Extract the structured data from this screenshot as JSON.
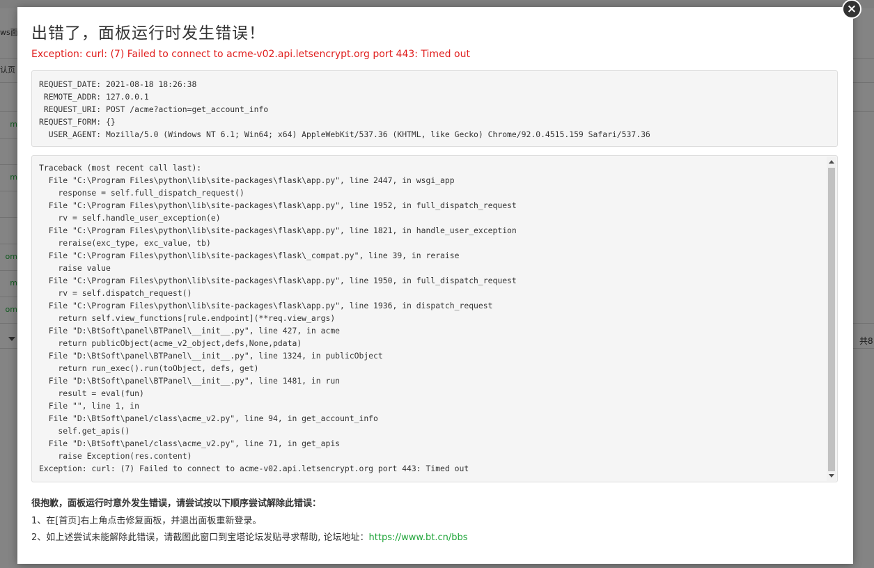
{
  "background": {
    "left_texts": [
      "ws面",
      "认页"
    ],
    "left_links": [
      "m",
      "m",
      "om",
      "m",
      "om"
    ],
    "right_text": "共8"
  },
  "dialog": {
    "title": "出错了，面板运行时发生错误！",
    "exception": "Exception: curl: (7) Failed to connect to acme-v02.api.letsencrypt.org port 443: Timed out",
    "close_icon": "close-icon",
    "request_info": [
      "REQUEST_DATE: 2021-08-18 18:26:38",
      " REMOTE_ADDR: 127.0.0.1",
      " REQUEST_URI: POST /acme?action=get_account_info",
      "REQUEST_FORM: {}",
      "  USER_AGENT: Mozilla/5.0 (Windows NT 6.1; Win64; x64) AppleWebKit/537.36 (KHTML, like Gecko) Chrome/92.0.4515.159 Safari/537.36"
    ],
    "traceback": [
      "Traceback (most recent call last):",
      "  File \"C:\\Program Files\\python\\lib\\site-packages\\flask\\app.py\", line 2447, in wsgi_app",
      "    response = self.full_dispatch_request()",
      "  File \"C:\\Program Files\\python\\lib\\site-packages\\flask\\app.py\", line 1952, in full_dispatch_request",
      "    rv = self.handle_user_exception(e)",
      "  File \"C:\\Program Files\\python\\lib\\site-packages\\flask\\app.py\", line 1821, in handle_user_exception",
      "    reraise(exc_type, exc_value, tb)",
      "  File \"C:\\Program Files\\python\\lib\\site-packages\\flask\\_compat.py\", line 39, in reraise",
      "    raise value",
      "  File \"C:\\Program Files\\python\\lib\\site-packages\\flask\\app.py\", line 1950, in full_dispatch_request",
      "    rv = self.dispatch_request()",
      "  File \"C:\\Program Files\\python\\lib\\site-packages\\flask\\app.py\", line 1936, in dispatch_request",
      "    return self.view_functions[rule.endpoint](**req.view_args)",
      "  File \"D:\\BtSoft\\panel\\BTPanel\\__init__.py\", line 427, in acme",
      "    return publicObject(acme_v2_object,defs,None,pdata)",
      "  File \"D:\\BtSoft\\panel\\BTPanel\\__init__.py\", line 1324, in publicObject",
      "    return run_exec().run(toObject, defs, get)",
      "  File \"D:\\BtSoft\\panel\\BTPanel\\__init__.py\", line 1481, in run",
      "    result = eval(fun)",
      "  File \"\", line 1, in",
      "  File \"D:\\BtSoft\\panel/class\\acme_v2.py\", line 94, in get_account_info",
      "    self.get_apis()",
      "  File \"D:\\BtSoft\\panel/class\\acme_v2.py\", line 71, in get_apis",
      "    raise Exception(res.content)",
      "Exception: curl: (7) Failed to connect to acme-v02.api.letsencrypt.org port 443: Timed out"
    ],
    "help_title": "很抱歉，面板运行时意外发生错误，请尝试按以下顺序尝试解除此错误：",
    "help_step1": "1、在[首页]右上角点击修复面板，并退出面板重新登录。",
    "help_step2_text": "2、如上述尝试未能解除此错误，请截图此窗口到宝塔论坛发贴寻求帮助, 论坛地址：",
    "help_step2_link": "https://www.bt.cn/bbs"
  }
}
